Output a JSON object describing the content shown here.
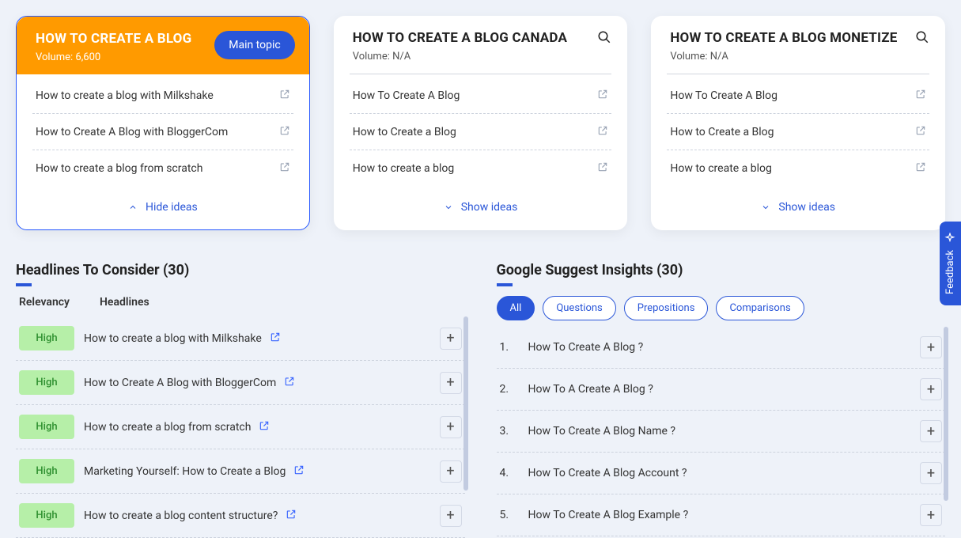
{
  "cards": [
    {
      "title": "HOW TO CREATE A BLOG",
      "volume": "Volume: 6,600",
      "main_topic_label": "Main topic",
      "is_main": true,
      "toggle": "Hide ideas",
      "ideas": [
        "How to create a blog with Milkshake",
        "How to Create A Blog with BloggerCom",
        "How to create a blog from scratch"
      ]
    },
    {
      "title": "HOW TO CREATE A BLOG CANADA",
      "volume": "Volume: N/A",
      "toggle": "Show ideas",
      "ideas": [
        "How To Create A Blog",
        "How to Create a Blog",
        "How to create a blog"
      ]
    },
    {
      "title": "HOW TO CREATE A BLOG MONETIZE",
      "volume": "Volume: N/A",
      "toggle": "Show ideas",
      "ideas": [
        "How To Create A Blog",
        "How to Create a Blog",
        "How to create a blog"
      ]
    }
  ],
  "headlines": {
    "title": "Headlines To Consider (30)",
    "col_relevancy": "Relevancy",
    "col_headlines": "Headlines",
    "rows": [
      {
        "relevancy": "High",
        "text": "How to create a blog with Milkshake"
      },
      {
        "relevancy": "High",
        "text": "How to Create A Blog with BloggerCom"
      },
      {
        "relevancy": "High",
        "text": "How to create a blog from scratch"
      },
      {
        "relevancy": "High",
        "text": "Marketing Yourself: How to Create a Blog"
      },
      {
        "relevancy": "High",
        "text": "How to create a blog content structure?"
      }
    ]
  },
  "insights": {
    "title": "Google Suggest Insights (30)",
    "tabs": [
      "All",
      "Questions",
      "Prepositions",
      "Comparisons"
    ],
    "rows": [
      {
        "n": "1.",
        "q": "How To Create A Blog ?"
      },
      {
        "n": "2.",
        "q": "How To A Create A Blog ?"
      },
      {
        "n": "3.",
        "q": "How To Create A Blog Name ?"
      },
      {
        "n": "4.",
        "q": "How To Create A Blog Account ?"
      },
      {
        "n": "5.",
        "q": "How To Create A Blog Example ?"
      }
    ]
  },
  "feedback_label": "Feedback"
}
